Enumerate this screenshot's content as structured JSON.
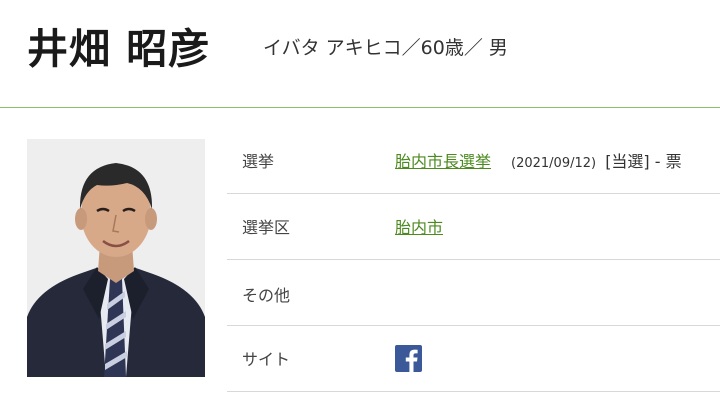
{
  "profile": {
    "name": "井畑 昭彦",
    "reading_age_gender": "イバタ アキヒコ／60歳／ 男"
  },
  "details": {
    "election_label": "選挙",
    "election_link": "胎内市長選挙",
    "election_date": "(2021/09/12)",
    "election_result": "[当選] - 票",
    "district_label": "選挙区",
    "district_link": "胎内市",
    "other_label": "その他",
    "site_label": "サイト"
  },
  "colors": {
    "link": "#4c8a1f",
    "divider_accent": "#8cc063",
    "facebook": "#3b5998"
  },
  "icons": {
    "site": "facebook-icon"
  }
}
